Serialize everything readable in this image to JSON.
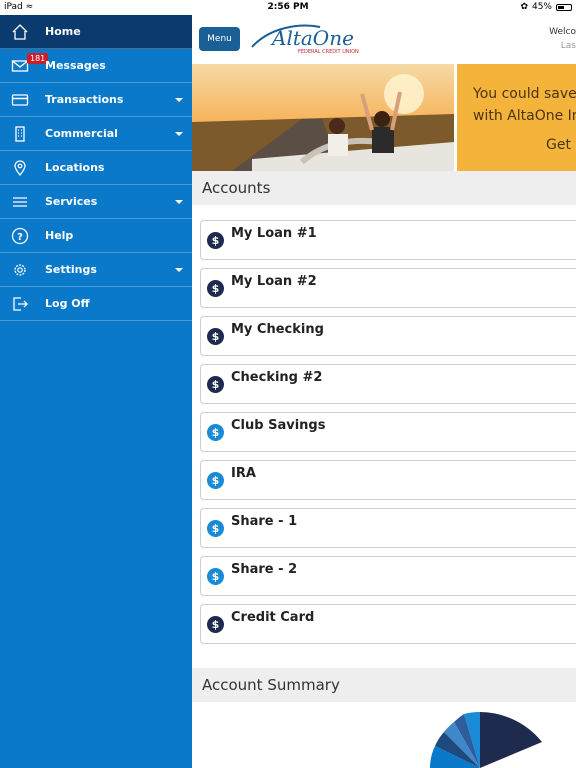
{
  "status_bar": {
    "device": "iPad",
    "time": "2:56 PM",
    "battery": "45%"
  },
  "sidebar": {
    "items": [
      {
        "label": "Home",
        "icon": "home-icon",
        "active": true,
        "expandable": false
      },
      {
        "label": "Messages",
        "icon": "mail-icon",
        "active": false,
        "expandable": false,
        "badge": "181"
      },
      {
        "label": "Transactions",
        "icon": "credit-card-icon",
        "active": false,
        "expandable": true
      },
      {
        "label": "Commercial",
        "icon": "building-icon",
        "active": false,
        "expandable": true
      },
      {
        "label": "Locations",
        "icon": "map-pin-icon",
        "active": false,
        "expandable": false
      },
      {
        "label": "Services",
        "icon": "list-icon",
        "active": false,
        "expandable": true
      },
      {
        "label": "Help",
        "icon": "help-icon",
        "active": false,
        "expandable": false
      },
      {
        "label": "Settings",
        "icon": "gear-icon",
        "active": false,
        "expandable": true
      },
      {
        "label": "Log Off",
        "icon": "logout-icon",
        "active": false,
        "expandable": false
      }
    ]
  },
  "header": {
    "menu_label": "Menu",
    "logo_text": "AltaOne",
    "logo_subtext": "FEDERAL CREDIT UNION",
    "welcome": "Welco",
    "last": "Las"
  },
  "banner": {
    "ad_lines": [
      "You could save",
      "with AltaOne In",
      "Get y"
    ]
  },
  "accounts_section": {
    "title": "Accounts",
    "accounts": [
      {
        "name": "My Loan #1",
        "color": "#1f2a4f"
      },
      {
        "name": "My Loan #2",
        "color": "#1f2a4f"
      },
      {
        "name": "My Checking",
        "color": "#1f2a4f"
      },
      {
        "name": "Checking #2",
        "color": "#1f2a4f"
      },
      {
        "name": "Club Savings",
        "color": "#1a8bd4"
      },
      {
        "name": "IRA",
        "color": "#1a8bd4"
      },
      {
        "name": "Share - 1",
        "color": "#1a8bd4"
      },
      {
        "name": "Share - 2",
        "color": "#1a8bd4"
      },
      {
        "name": "Credit Card",
        "color": "#1f2a4f"
      }
    ]
  },
  "summary_section": {
    "title": "Account Summary"
  },
  "colors": {
    "sidebar": "#0b79c9",
    "sidebar_active": "#0a3a6e",
    "menu_button": "#1b5f97",
    "ad_background": "#f4b43b"
  }
}
